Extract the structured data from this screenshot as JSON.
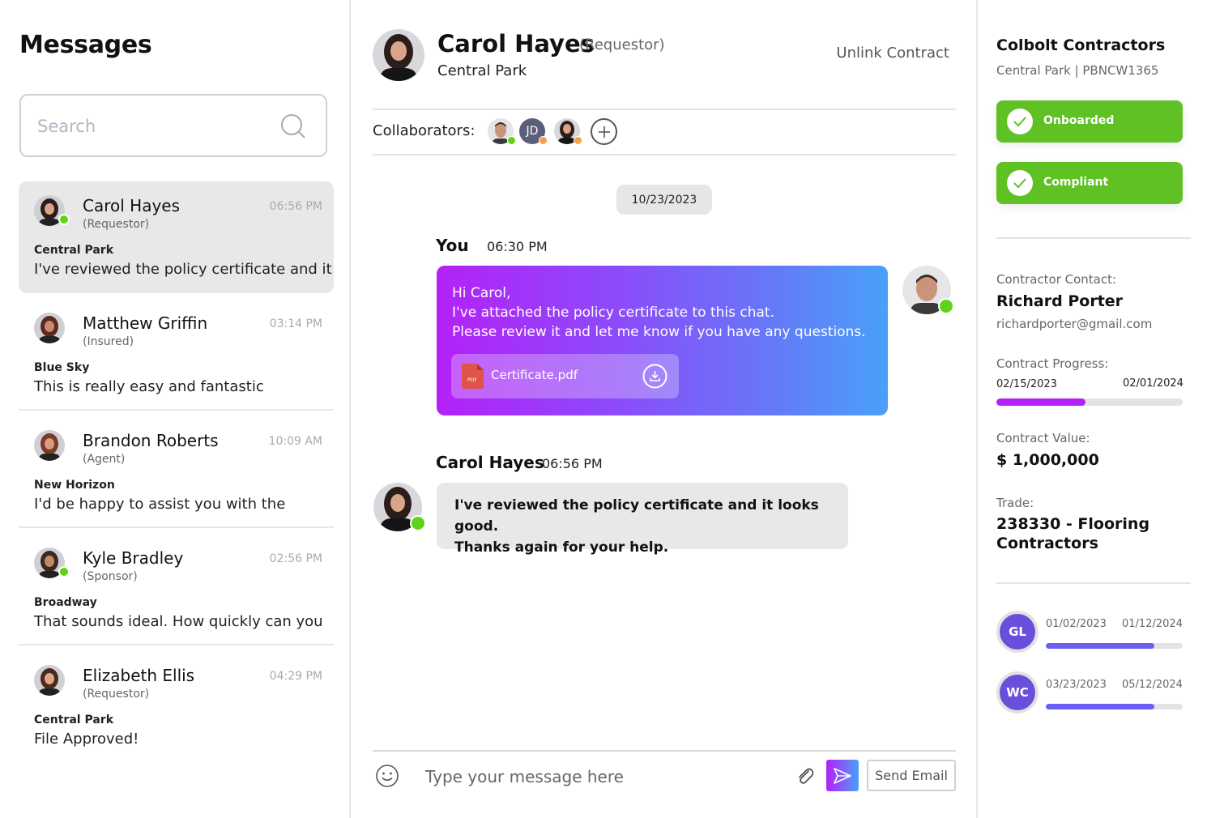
{
  "sidebar": {
    "title": "Messages",
    "search_placeholder": "Search",
    "conversations": [
      {
        "name": "Carol Hayes",
        "role": "(Requestor)",
        "time": "06:56 PM",
        "project": "Central Park",
        "preview": "I've reviewed the policy certificate and it",
        "online": true,
        "active": true
      },
      {
        "name": "Matthew Griffin",
        "role": "(Insured)",
        "time": "03:14 PM",
        "project": "Blue Sky",
        "preview": "This is really easy and fantastic",
        "online": false,
        "active": false
      },
      {
        "name": "Brandon Roberts",
        "role": "(Agent)",
        "time": "10:09 AM",
        "project": "New Horizon",
        "preview": "I'd be happy to assist you with the",
        "online": false,
        "active": false
      },
      {
        "name": "Kyle Bradley",
        "role": "(Sponsor)",
        "time": "02:56 PM",
        "project": "Broadway",
        "preview": "That sounds ideal. How quickly can you",
        "online": true,
        "active": false
      },
      {
        "name": "Elizabeth Ellis",
        "role": "(Requestor)",
        "time": "04:29 PM",
        "project": "Central Park",
        "preview": "File Approved!",
        "online": false,
        "active": false
      }
    ]
  },
  "chat": {
    "header": {
      "name": "Carol Hayes",
      "role": "(Requestor)",
      "project": "Central Park",
      "unlink_label": "Unlink Contract"
    },
    "collaborators_label": "Collaborators:",
    "collaborators": [
      {
        "type": "photo",
        "status_color": "#5fd31a"
      },
      {
        "type": "initials",
        "initials": "JD",
        "status_color": "#f5a04a"
      },
      {
        "type": "photo",
        "status_color": "#f5a04a"
      }
    ],
    "date_chip": "10/23/2023",
    "messages": [
      {
        "sender": "You",
        "time": "06:30 PM",
        "lines": [
          "Hi Carol,",
          "I've attached the policy certificate to this chat.",
          "Please review it and let me know if you have any questions."
        ],
        "attachment": {
          "name": "Certificate.pdf",
          "type_label": "PDF"
        }
      },
      {
        "sender": "Carol Hayes",
        "time": "06:56 PM",
        "lines": [
          "I've reviewed the policy certificate and it looks good.",
          "Thanks again for your help."
        ]
      }
    ],
    "composer": {
      "placeholder": "Type your message here",
      "send_email_label": "Send Email"
    }
  },
  "details": {
    "company": "Colbolt Contractors",
    "subtitle": "Central Park | PBNCW1365",
    "statuses": [
      {
        "label": "Onboarded",
        "color": "#5fc124"
      },
      {
        "label": "Compliant",
        "color": "#5fc124"
      }
    ],
    "contact_label": "Contractor Contact:",
    "contact_name": "Richard Porter",
    "contact_email": "richardporter@gmail.com",
    "progress_label": "Contract Progress:",
    "progress_start": "02/15/2023",
    "progress_end": "02/01/2024",
    "progress_fraction": 0.48,
    "progress_color": "#b421f8",
    "value_label": "Contract Value:",
    "value": "$ 1,000,000",
    "trade_label": "Trade:",
    "trade_lines": [
      "238330 - Flooring",
      "Contractors"
    ],
    "coverages": [
      {
        "code": "GL",
        "start": "01/02/2023",
        "end": "01/12/2024",
        "fraction": 0.79,
        "color": "#6a5ff5"
      },
      {
        "code": "WC",
        "start": "03/23/2023",
        "end": "05/12/2024",
        "fraction": 0.79,
        "color": "#6a5ff5"
      }
    ]
  }
}
